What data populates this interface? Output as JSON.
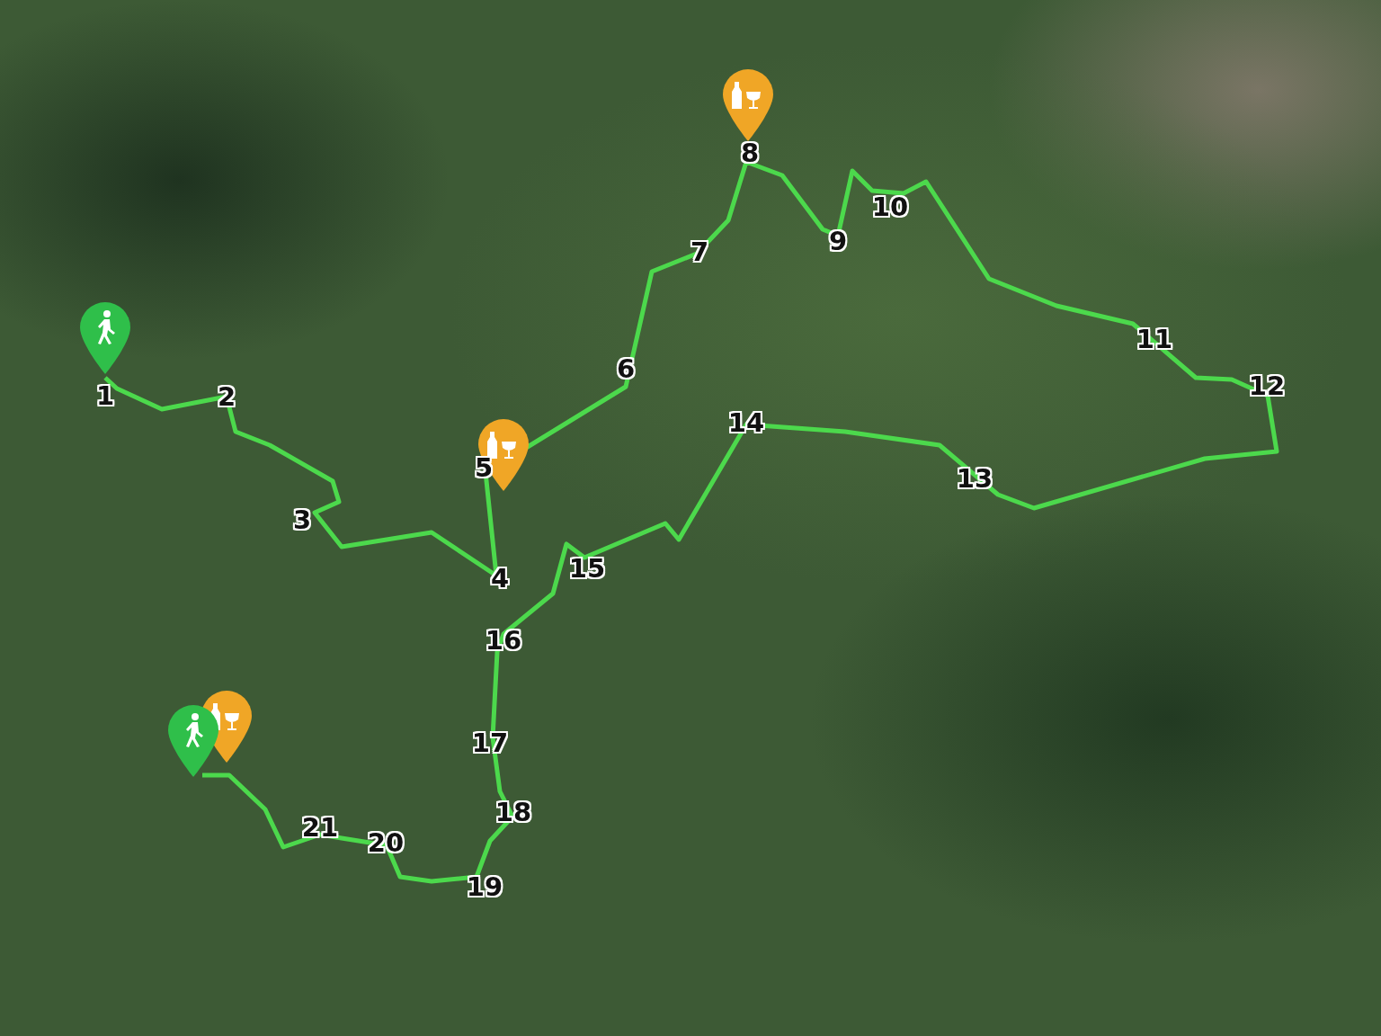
{
  "map": {
    "waypoints": [
      {
        "label": "1"
      },
      {
        "label": "2"
      },
      {
        "label": "3"
      },
      {
        "label": "4"
      },
      {
        "label": "5"
      },
      {
        "label": "6"
      },
      {
        "label": "7"
      },
      {
        "label": "8"
      },
      {
        "label": "9"
      },
      {
        "label": "10"
      },
      {
        "label": "11"
      },
      {
        "label": "12"
      },
      {
        "label": "13"
      },
      {
        "label": "14"
      },
      {
        "label": "15"
      },
      {
        "label": "16"
      },
      {
        "label": "17"
      },
      {
        "label": "18"
      },
      {
        "label": "19"
      },
      {
        "label": "20"
      },
      {
        "label": "21"
      }
    ],
    "markers": [
      {
        "kind": "walk"
      },
      {
        "kind": "drinks"
      },
      {
        "kind": "drinks"
      },
      {
        "kind": "drinks"
      },
      {
        "kind": "walk"
      }
    ]
  }
}
